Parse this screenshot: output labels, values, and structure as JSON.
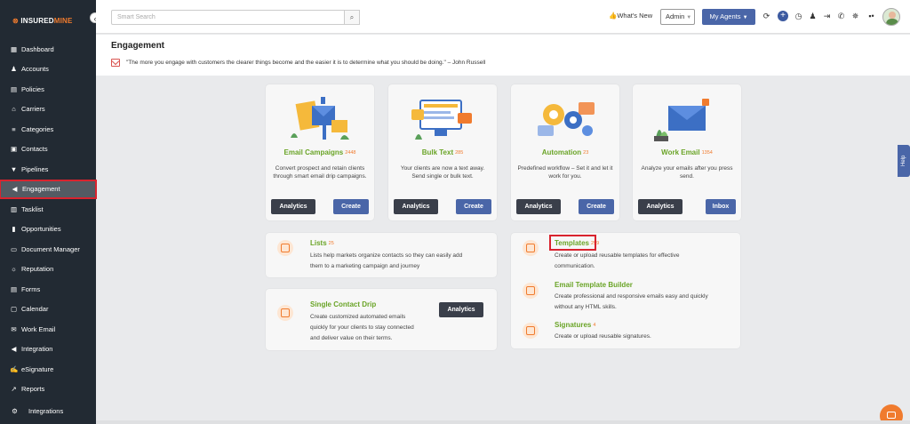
{
  "app": {
    "logo_prefix": "INSURED",
    "logo_suffix": "MINE"
  },
  "sidebar": {
    "items": [
      {
        "icon": "dashboard-icon",
        "glyph": "▦",
        "label": "Dashboard"
      },
      {
        "icon": "accounts-icon",
        "glyph": "♟",
        "label": "Accounts"
      },
      {
        "icon": "policies-icon",
        "glyph": "▤",
        "label": "Policies"
      },
      {
        "icon": "carriers-icon",
        "glyph": "⌂",
        "label": "Carriers"
      },
      {
        "icon": "categories-icon",
        "glyph": "≡",
        "label": "Categories"
      },
      {
        "icon": "contacts-icon",
        "glyph": "▣",
        "label": "Contacts"
      },
      {
        "icon": "pipelines-icon",
        "glyph": "▼",
        "label": "Pipelines"
      },
      {
        "icon": "engagement-icon",
        "glyph": "◀",
        "label": "Engagement"
      },
      {
        "icon": "tasklist-icon",
        "glyph": "▥",
        "label": "Tasklist"
      },
      {
        "icon": "opportunities-icon",
        "glyph": "▮",
        "label": "Opportunities"
      },
      {
        "icon": "document-manager-icon",
        "glyph": "▭",
        "label": "Document Manager"
      },
      {
        "icon": "reputation-icon",
        "glyph": "☼",
        "label": "Reputation"
      },
      {
        "icon": "forms-icon",
        "glyph": "▤",
        "label": "Forms"
      },
      {
        "icon": "calendar-icon",
        "glyph": "▢",
        "label": "Calendar"
      },
      {
        "icon": "work-email-icon",
        "glyph": "✉",
        "label": "Work Email"
      },
      {
        "icon": "integration-icon",
        "glyph": "◀",
        "label": "Integration"
      },
      {
        "icon": "esignature-icon",
        "glyph": "✍",
        "label": "eSignature"
      },
      {
        "icon": "reports-icon",
        "glyph": "↗",
        "label": "Reports"
      },
      {
        "icon": "integrations-icon",
        "glyph": "⚙",
        "label": "Integrations"
      }
    ]
  },
  "topbar": {
    "search_placeholder": "Smart Search",
    "whats_new": "What's New",
    "admin_label": "Admin",
    "agents_label": "My Agents"
  },
  "page": {
    "title": "Engagement",
    "quote": "\"The more you engage with customers the clearer things become and the easier it is to determine what you should be doing.\" – John Russell"
  },
  "cards": [
    {
      "title": "Email Campaigns",
      "count": "2448",
      "desc": "Convert prospect and retain clients through smart email drip campaigns.",
      "btn1": "Analytics",
      "btn2": "Create"
    },
    {
      "title": "Bulk Text",
      "count": "285",
      "desc": "Your clients are now a text away. Send single or bulk text.",
      "btn1": "Analytics",
      "btn2": "Create"
    },
    {
      "title": "Automation",
      "count": "23",
      "desc": "Predefined workflow – Set it and let it work for you.",
      "btn1": "Analytics",
      "btn2": "Create"
    },
    {
      "title": "Work Email",
      "count": "1354",
      "desc": "Analyze your emails after you press send.",
      "btn1": "Analytics",
      "btn2": "Inbox"
    }
  ],
  "lists": {
    "title": "Lists",
    "count": "25",
    "desc1": "Lists help markets organize contacts so they can easily add",
    "desc2": "them to a marketing campaign and journey"
  },
  "drip": {
    "title": "Single Contact Drip",
    "desc1": "Create customized automated emails",
    "desc2": "quickly for your clients to stay connected",
    "desc3": "and deliver value on their terms.",
    "btn": "Analytics"
  },
  "templates": {
    "title": "Templates",
    "count": "299",
    "desc1": "Create or upload reusable templates for effective",
    "desc2": "communication."
  },
  "builder": {
    "title": "Email Template Builder",
    "desc1": "Create professional and responsive emails easy and quickly",
    "desc2": "without any HTML skills."
  },
  "signatures": {
    "title": "Signatures",
    "count": "4",
    "desc1": "Create or upload reusable signatures."
  },
  "help_label": "Help",
  "colors": {
    "accent_green": "#6aa427",
    "accent_orange": "#f07b2e",
    "primary_blue": "#4a66a8",
    "highlight_red": "#d9232e",
    "sidebar_bg": "#222a33"
  }
}
